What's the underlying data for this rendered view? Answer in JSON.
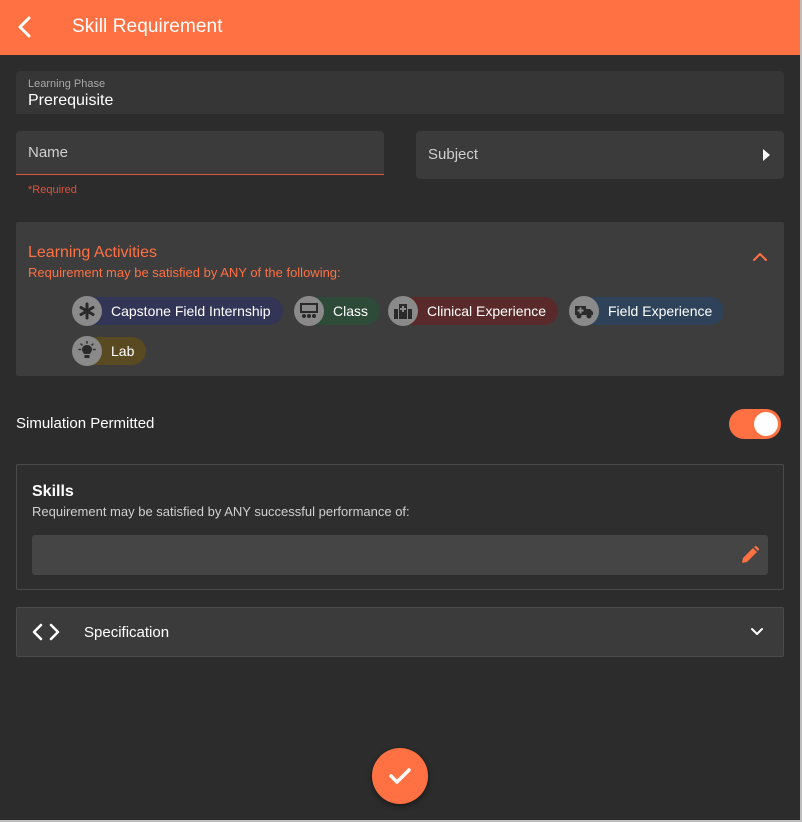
{
  "header": {
    "title": "Skill Requirement",
    "back_icon": "chevron-left-icon"
  },
  "learning_phase": {
    "label": "Learning Phase",
    "value": "Prerequisite"
  },
  "name_field": {
    "placeholder": "Name",
    "value": "",
    "helper": "*Required"
  },
  "subject_field": {
    "placeholder": "Subject",
    "arrow_icon": "caret-right-icon"
  },
  "learning_activities": {
    "title": "Learning Activities",
    "subtitle": "Requirement may be satisfied by ANY of the following:",
    "collapse_icon": "chevron-up-icon",
    "chips": [
      {
        "label": "Capstone Field Internship",
        "icon": "asterisk-icon",
        "color": "#323556"
      },
      {
        "label": "Class",
        "icon": "classroom-icon",
        "color": "#2e4a38"
      },
      {
        "label": "Clinical Experience",
        "icon": "hospital-icon",
        "color": "#5a2a2a"
      },
      {
        "label": "Field Experience",
        "icon": "ambulance-icon",
        "color": "#2e435a"
      },
      {
        "label": "Lab",
        "icon": "lightbulb-icon",
        "color": "#5a4a22"
      }
    ]
  },
  "simulation": {
    "label": "Simulation Permitted",
    "enabled": true
  },
  "skills": {
    "title": "Skills",
    "subtitle": "Requirement may be satisfied by ANY successful performance of:",
    "edit_icon": "pencil-icon"
  },
  "specification": {
    "label": "Specification",
    "icon": "code-brackets-icon",
    "expand_icon": "chevron-down-icon"
  },
  "fab": {
    "icon": "check-icon"
  },
  "colors": {
    "accent": "#ff7043",
    "background": "#2c2c2c",
    "error": "#e0523a"
  }
}
